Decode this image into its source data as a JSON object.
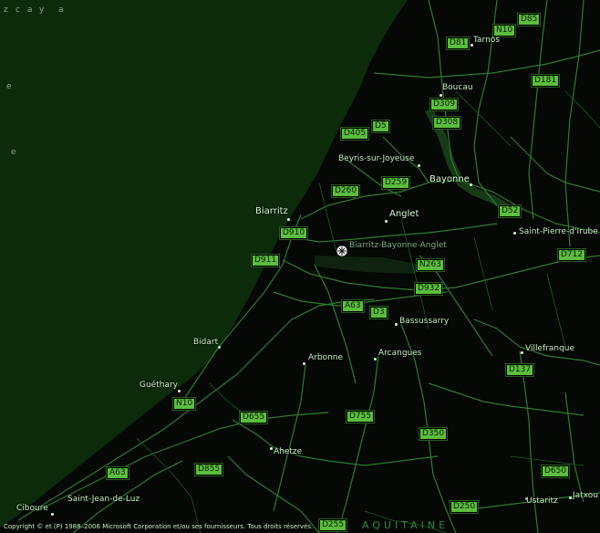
{
  "sea_label_letters": [
    "z",
    "c",
    "a",
    "y",
    "a",
    "e",
    "e"
  ],
  "places": {
    "tarnos": "Tarnos",
    "boucau": "Boucau",
    "beyris": "Beyris-sur-Joyeuse",
    "bayonne": "Bayonne",
    "biarritz": "Biarritz",
    "anglet": "Anglet",
    "airport": "Biarritz-Bayonne-Anglet",
    "saint_pierre": "Saint-Pierre-d'Irube",
    "bassussarry": "Bassussarry",
    "bidart": "Bidart",
    "arbonne": "Arbonne",
    "arcangues": "Arcangues",
    "villefranque": "Villefranque",
    "guethary": "Guéthary",
    "ahetze": "Ahetze",
    "ustaritz": "Ustaritz",
    "jatxou": "Jatxou",
    "ciboure": "Ciboure",
    "saint_jean": "Saint-Jean-de-Luz"
  },
  "roads": {
    "d85": "D85",
    "n10_north": "N10",
    "d81": "D81",
    "d181": "D181",
    "d309": "D309",
    "d308": "D308",
    "d5": "D5",
    "d405": "D405",
    "d260": "D260",
    "d259": "D259",
    "d52": "D52",
    "d910": "D910",
    "d911": "D911",
    "d712": "D712",
    "n263": "N263",
    "d932": "D932",
    "a63_mid": "A63",
    "d3": "D3",
    "d137": "D137",
    "n10_south": "N10",
    "d655": "D655",
    "d755": "D755",
    "d350": "D350",
    "a63_south": "A63",
    "d855": "D855",
    "d650": "D650",
    "d250": "D250",
    "d255": "D255"
  },
  "region_label": "AQUITAINE",
  "copyright": "Copyright © et (P) 1988–2006 Microsoft Corporation et/ou ses fournisseurs. Tous droits réservés.",
  "colors": {
    "sea": "#0b2b0b",
    "land": "#050805",
    "road": "#2f7a2f",
    "shield": "#5cbd3e"
  },
  "icons": {
    "airport": "airport-icon"
  }
}
